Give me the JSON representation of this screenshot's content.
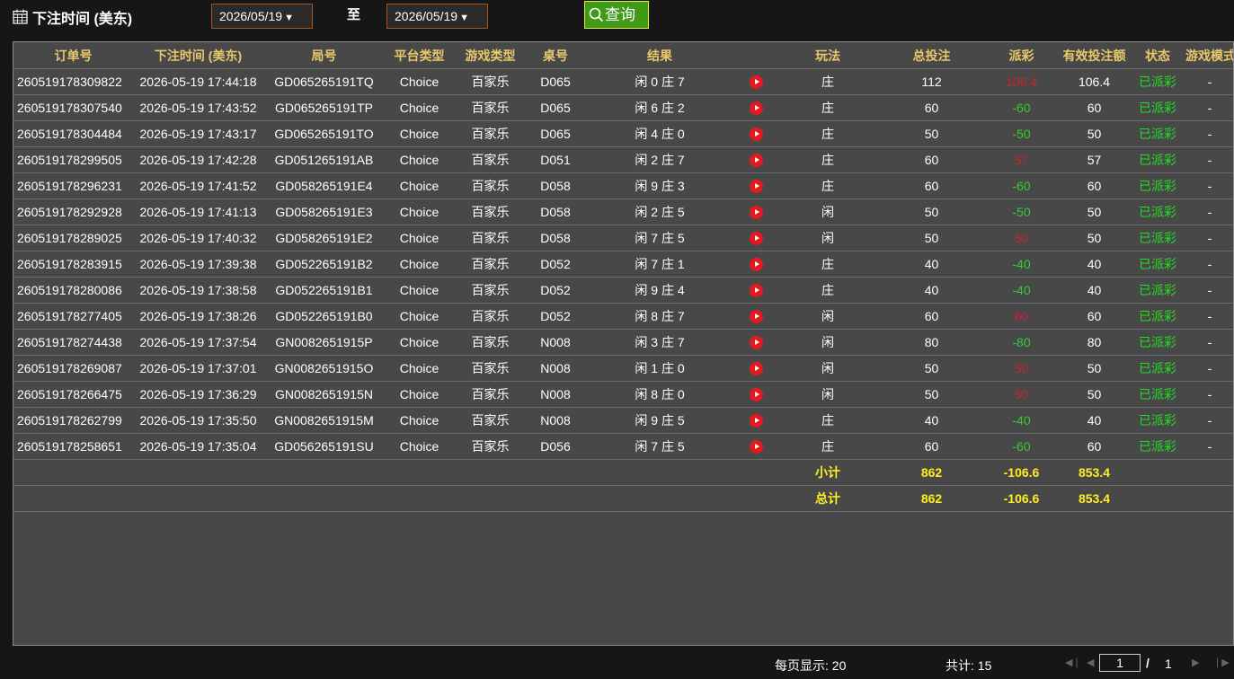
{
  "topbar": {
    "label": "下注时间 (美东)",
    "start_date": "2026/05/19",
    "end_date": "2026/05/19",
    "to_label": "至",
    "query_label": "查询"
  },
  "table": {
    "columns": [
      "订单号",
      "下注时间 (美东)",
      "局号",
      "平台类型",
      "游戏类型",
      "桌号",
      "结果",
      "",
      "玩法",
      "总投注",
      "派彩",
      "有效投注额",
      "状态",
      "游戏模式"
    ],
    "rows": [
      {
        "order": "260519178309822",
        "time": "2026-05-19 17:44:18",
        "round": "GD065265191TQ",
        "platform": "Choice",
        "game": "百家乐",
        "table": "D065",
        "result": "闲 0 庄 7",
        "bet_type": "庄",
        "total": "112",
        "payout": "106.4",
        "payout_color": "red",
        "valid": "106.4",
        "status": "已派彩",
        "mode": "-"
      },
      {
        "order": "260519178307540",
        "time": "2026-05-19 17:43:52",
        "round": "GD065265191TP",
        "platform": "Choice",
        "game": "百家乐",
        "table": "D065",
        "result": "闲 6 庄 2",
        "bet_type": "庄",
        "total": "60",
        "payout": "-60",
        "payout_color": "green",
        "valid": "60",
        "status": "已派彩",
        "mode": "-"
      },
      {
        "order": "260519178304484",
        "time": "2026-05-19 17:43:17",
        "round": "GD065265191TO",
        "platform": "Choice",
        "game": "百家乐",
        "table": "D065",
        "result": "闲 4 庄 0",
        "bet_type": "庄",
        "total": "50",
        "payout": "-50",
        "payout_color": "green",
        "valid": "50",
        "status": "已派彩",
        "mode": "-"
      },
      {
        "order": "260519178299505",
        "time": "2026-05-19 17:42:28",
        "round": "GD051265191AB",
        "platform": "Choice",
        "game": "百家乐",
        "table": "D051",
        "result": "闲 2 庄 7",
        "bet_type": "庄",
        "total": "60",
        "payout": "57",
        "payout_color": "red",
        "valid": "57",
        "status": "已派彩",
        "mode": "-"
      },
      {
        "order": "260519178296231",
        "time": "2026-05-19 17:41:52",
        "round": "GD058265191E4",
        "platform": "Choice",
        "game": "百家乐",
        "table": "D058",
        "result": "闲 9 庄 3",
        "bet_type": "庄",
        "total": "60",
        "payout": "-60",
        "payout_color": "green",
        "valid": "60",
        "status": "已派彩",
        "mode": "-"
      },
      {
        "order": "260519178292928",
        "time": "2026-05-19 17:41:13",
        "round": "GD058265191E3",
        "platform": "Choice",
        "game": "百家乐",
        "table": "D058",
        "result": "闲 2 庄 5",
        "bet_type": "闲",
        "total": "50",
        "payout": "-50",
        "payout_color": "green",
        "valid": "50",
        "status": "已派彩",
        "mode": "-"
      },
      {
        "order": "260519178289025",
        "time": "2026-05-19 17:40:32",
        "round": "GD058265191E2",
        "platform": "Choice",
        "game": "百家乐",
        "table": "D058",
        "result": "闲 7 庄 5",
        "bet_type": "闲",
        "total": "50",
        "payout": "50",
        "payout_color": "red",
        "valid": "50",
        "status": "已派彩",
        "mode": "-"
      },
      {
        "order": "260519178283915",
        "time": "2026-05-19 17:39:38",
        "round": "GD052265191B2",
        "platform": "Choice",
        "game": "百家乐",
        "table": "D052",
        "result": "闲 7 庄 1",
        "bet_type": "庄",
        "total": "40",
        "payout": "-40",
        "payout_color": "green",
        "valid": "40",
        "status": "已派彩",
        "mode": "-"
      },
      {
        "order": "260519178280086",
        "time": "2026-05-19 17:38:58",
        "round": "GD052265191B1",
        "platform": "Choice",
        "game": "百家乐",
        "table": "D052",
        "result": "闲 9 庄 4",
        "bet_type": "庄",
        "total": "40",
        "payout": "-40",
        "payout_color": "green",
        "valid": "40",
        "status": "已派彩",
        "mode": "-"
      },
      {
        "order": "260519178277405",
        "time": "2026-05-19 17:38:26",
        "round": "GD052265191B0",
        "platform": "Choice",
        "game": "百家乐",
        "table": "D052",
        "result": "闲 8 庄 7",
        "bet_type": "闲",
        "total": "60",
        "payout": "60",
        "payout_color": "red",
        "valid": "60",
        "status": "已派彩",
        "mode": "-"
      },
      {
        "order": "260519178274438",
        "time": "2026-05-19 17:37:54",
        "round": "GN0082651915P",
        "platform": "Choice",
        "game": "百家乐",
        "table": "N008",
        "result": "闲 3 庄 7",
        "bet_type": "闲",
        "total": "80",
        "payout": "-80",
        "payout_color": "green",
        "valid": "80",
        "status": "已派彩",
        "mode": "-"
      },
      {
        "order": "260519178269087",
        "time": "2026-05-19 17:37:01",
        "round": "GN0082651915O",
        "platform": "Choice",
        "game": "百家乐",
        "table": "N008",
        "result": "闲 1 庄 0",
        "bet_type": "闲",
        "total": "50",
        "payout": "50",
        "payout_color": "red",
        "valid": "50",
        "status": "已派彩",
        "mode": "-"
      },
      {
        "order": "260519178266475",
        "time": "2026-05-19 17:36:29",
        "round": "GN0082651915N",
        "platform": "Choice",
        "game": "百家乐",
        "table": "N008",
        "result": "闲 8 庄 0",
        "bet_type": "闲",
        "total": "50",
        "payout": "50",
        "payout_color": "red",
        "valid": "50",
        "status": "已派彩",
        "mode": "-"
      },
      {
        "order": "260519178262799",
        "time": "2026-05-19 17:35:50",
        "round": "GN0082651915M",
        "platform": "Choice",
        "game": "百家乐",
        "table": "N008",
        "result": "闲 9 庄 5",
        "bet_type": "庄",
        "total": "40",
        "payout": "-40",
        "payout_color": "green",
        "valid": "40",
        "status": "已派彩",
        "mode": "-"
      },
      {
        "order": "260519178258651",
        "time": "2026-05-19 17:35:04",
        "round": "GD056265191SU",
        "platform": "Choice",
        "game": "百家乐",
        "table": "D056",
        "result": "闲 7 庄 5",
        "bet_type": "庄",
        "total": "60",
        "payout": "-60",
        "payout_color": "green",
        "valid": "60",
        "status": "已派彩",
        "mode": "-"
      }
    ],
    "subtotal": {
      "label": "小计",
      "total": "862",
      "payout": "-106.6",
      "valid": "853.4"
    },
    "grand_total": {
      "label": "总计",
      "total": "862",
      "payout": "-106.6",
      "valid": "853.4"
    }
  },
  "footer": {
    "per_page": "每页显示: 20",
    "total_count": "共计: 15",
    "current_page": "1",
    "total_pages": "1",
    "slash": "/"
  }
}
